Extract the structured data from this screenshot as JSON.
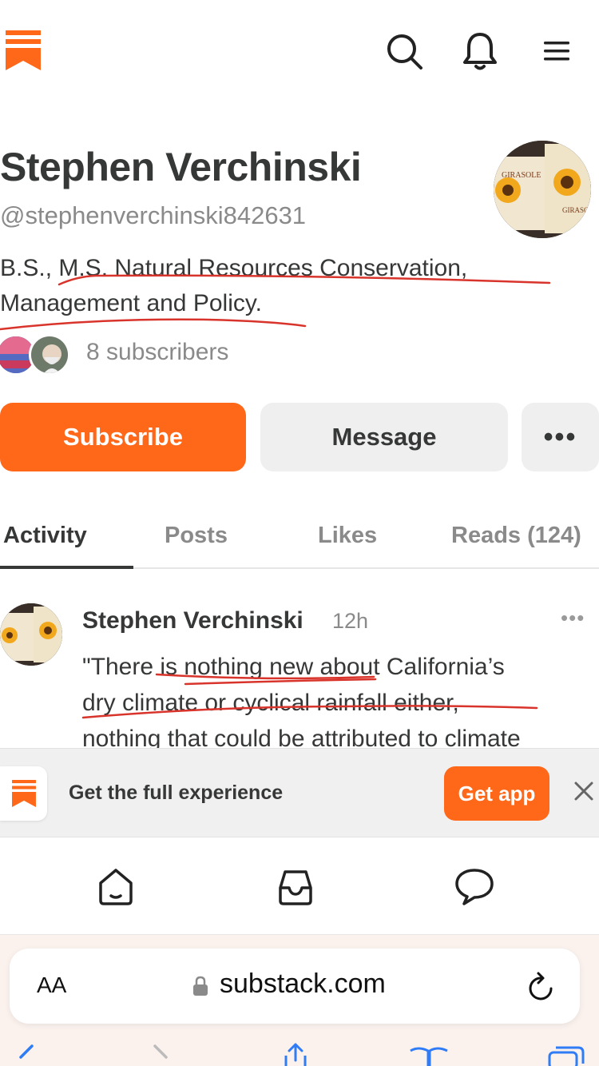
{
  "header": {
    "logo_icon": "substack-logo-icon",
    "brand_color": "#ff6719",
    "search_icon": "search-icon",
    "bell_icon": "bell-icon",
    "menu_icon": "hamburger-menu-icon"
  },
  "profile": {
    "name": "Stephen Verchinski",
    "handle": "@stephenverchinski842631",
    "bio_line1": "B.S., M.S. Natural Resources Conservation,",
    "bio_line2": "Management and Policy.",
    "subscribers": "8 subscribers",
    "avatar_text_1": "GIRASOLE",
    "avatar_text_2": "GIRASO"
  },
  "actions": {
    "subscribe": "Subscribe",
    "message": "Message",
    "more": "•••"
  },
  "tabs": [
    {
      "label": "Activity"
    },
    {
      "label": "Posts"
    },
    {
      "label": "Likes"
    },
    {
      "label": "Reads (124)"
    }
  ],
  "feed": {
    "author": "Stephen Verchinski",
    "time": "12h",
    "menu": "•••",
    "line1": "\"There is nothing new about California’s",
    "line2": "dry climate or cyclical rainfall either,",
    "line3": "nothing that could be attributed to climate"
  },
  "banner": {
    "text": "Get the full experience",
    "button": "Get app"
  },
  "app_nav": {
    "home_icon": "home-icon",
    "inbox_icon": "inbox-icon",
    "chat_icon": "chat-icon"
  },
  "browser": {
    "text_size": "AA",
    "url": "substack.com"
  },
  "colors": {
    "accent": "#ff6719",
    "text": "#363737",
    "muted": "#8a8a8a",
    "annotation": "#d9342b"
  }
}
